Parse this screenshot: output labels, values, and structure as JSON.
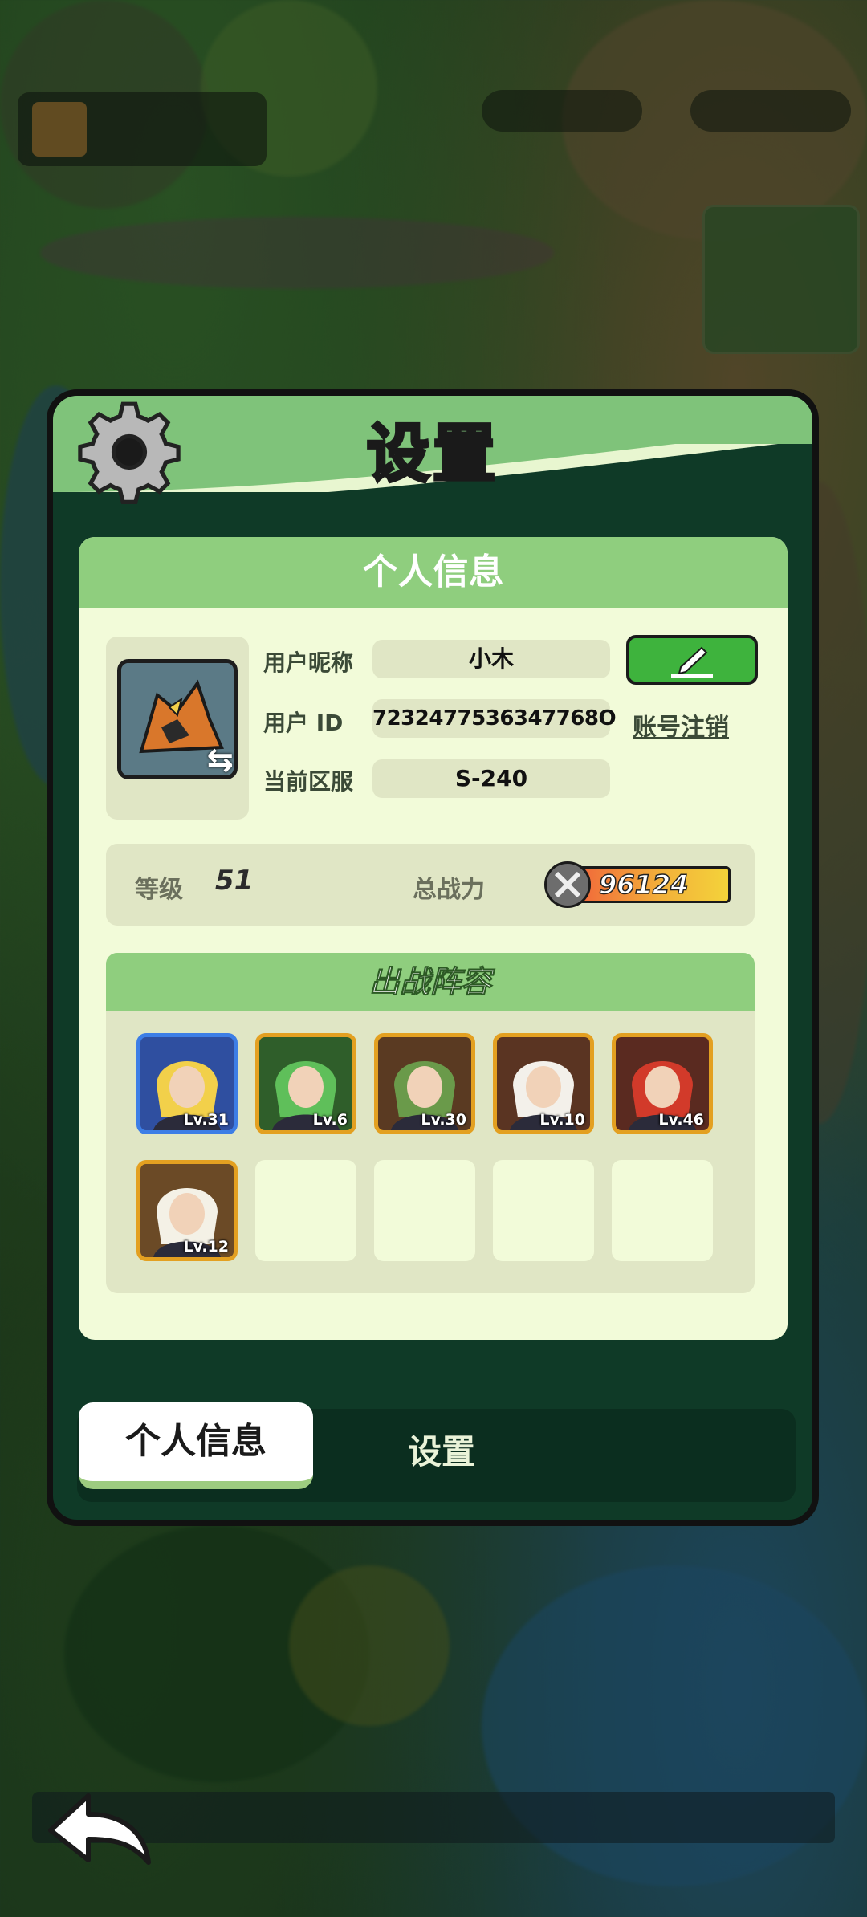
{
  "dialog": {
    "title": "设置",
    "icon": "gear-icon"
  },
  "profile": {
    "section_title": "个人信息",
    "nickname_label": "用户昵称",
    "nickname_value": "小木",
    "id_label": "用户 ID",
    "id_value": "7232477536347768O",
    "server_label": "当前区服",
    "server_value": "S-240",
    "deregister_label": "账号注销",
    "edit_icon": "pencil-icon",
    "swap_icon": "swap-arrows-icon"
  },
  "stats": {
    "level_label": "等级",
    "level_value": "51",
    "power_label": "总战力",
    "power_value": "96124"
  },
  "lineup": {
    "title": "出战阵容",
    "heroes": [
      {
        "lv": "Lv.31",
        "frame": "#3d7ee6",
        "bg": "#2f4fa0",
        "accent": "#f2d04a"
      },
      {
        "lv": "Lv.6",
        "frame": "#e3a021",
        "bg": "#2f5e2a",
        "accent": "#5fbf5a"
      },
      {
        "lv": "Lv.30",
        "frame": "#e3a021",
        "bg": "#5a3a22",
        "accent": "#6a9a4a"
      },
      {
        "lv": "Lv.10",
        "frame": "#e3a021",
        "bg": "#5a3422",
        "accent": "#f3f0ea"
      },
      {
        "lv": "Lv.46",
        "frame": "#e3a021",
        "bg": "#5a2a20",
        "accent": "#d23a2a"
      },
      {
        "lv": "Lv.12",
        "frame": "#e3a021",
        "bg": "#6b4a26",
        "accent": "#f4f1e6"
      }
    ],
    "empty_slots": 4
  },
  "tabs": {
    "active": "个人信息",
    "inactive": "设置"
  },
  "back_icon": "back-arrow-icon"
}
